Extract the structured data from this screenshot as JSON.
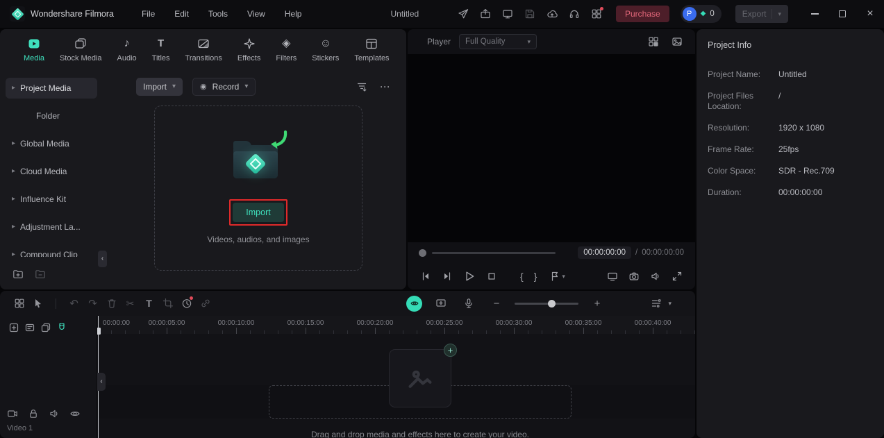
{
  "titlebar": {
    "app_title": "Wondershare Filmora",
    "menus": [
      "File",
      "Edit",
      "Tools",
      "View",
      "Help"
    ],
    "project_title": "Untitled",
    "purchase_label": "Purchase",
    "avatar_initial": "P",
    "points": "0",
    "export_label": "Export"
  },
  "icons": {
    "caret_down": "▾",
    "caret_right": "▸",
    "record": "◉",
    "more": "···",
    "music_note": "♪",
    "text_tool": "T",
    "filters_diamond": "◈",
    "smiley": "☺",
    "undo": "↶",
    "redo": "↷",
    "scissors": "✂",
    "mark_in": "{",
    "mark_out": "}",
    "minus": "−",
    "plus": "+",
    "collapse": "‹",
    "close": "×",
    "gem": "◆",
    "add": "+"
  },
  "media_panel": {
    "tabs": [
      {
        "label": "Media",
        "active": true
      },
      {
        "label": "Stock Media"
      },
      {
        "label": "Audio"
      },
      {
        "label": "Titles"
      },
      {
        "label": "Transitions"
      },
      {
        "label": "Effects"
      },
      {
        "label": "Filters"
      },
      {
        "label": "Stickers"
      },
      {
        "label": "Templates"
      }
    ],
    "sidebar": [
      "Project Media",
      "Folder",
      "Global Media",
      "Cloud Media",
      "Influence Kit",
      "Adjustment La...",
      "Compound Clip"
    ],
    "import_menu": "Import",
    "record_menu": "Record",
    "import_cta": "Import",
    "hint": "Videos, audios, and images"
  },
  "player": {
    "label": "Player",
    "quality": "Full Quality",
    "time_current": "00:00:00:00",
    "time_sep": "/",
    "time_total": "00:00:00:00"
  },
  "project_info": {
    "title": "Project Info",
    "rows": [
      {
        "label": "Project Name:",
        "value": "Untitled"
      },
      {
        "label": "Project Files Location:",
        "value": "/"
      },
      {
        "label": "Resolution:",
        "value": "1920 x 1080"
      },
      {
        "label": "Frame Rate:",
        "value": "25fps"
      },
      {
        "label": "Color Space:",
        "value": "SDR - Rec.709"
      },
      {
        "label": "Duration:",
        "value": "00:00:00:00"
      }
    ]
  },
  "timeline": {
    "ruler": [
      "00:00:00",
      "00:00:05:00",
      "00:00:10:00",
      "00:00:15:00",
      "00:00:20:00",
      "00:00:25:00",
      "00:00:30:00",
      "00:00:35:00",
      "00:00:40:00"
    ],
    "track_label": "Video 1",
    "hint": "Drag and drop media and effects here to create your video."
  },
  "colors": {
    "accent": "#3fe0bd",
    "annotation_red": "#e02a2a",
    "purchase_bg": "#4d1e29",
    "purchase_text": "#e2677a",
    "avatar_blue": "#3a6cf0"
  }
}
